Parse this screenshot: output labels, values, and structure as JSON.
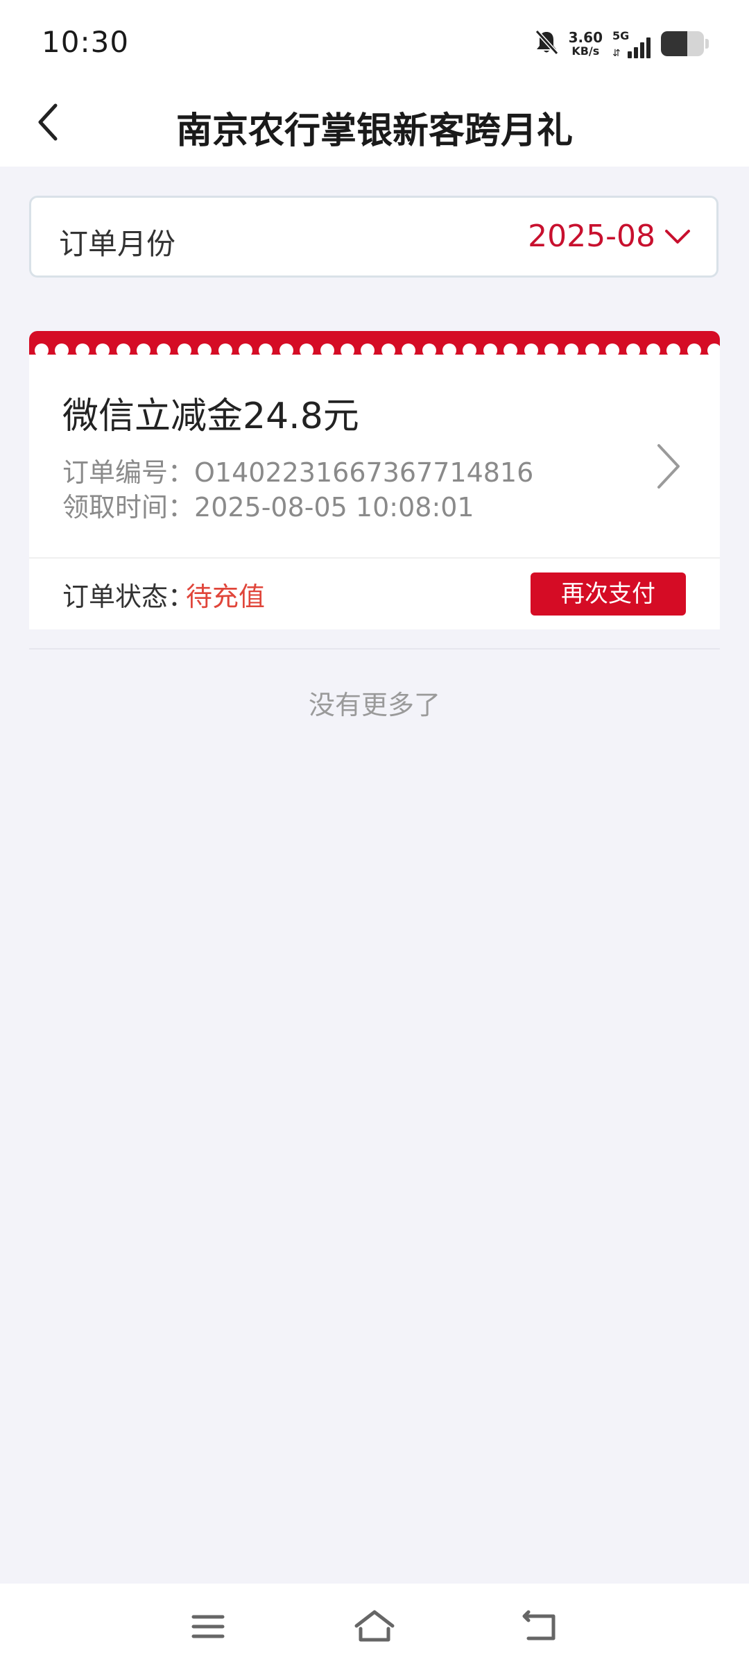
{
  "status_bar": {
    "time": "10:30",
    "net_speed_value": "3.60",
    "net_speed_unit": "KB/s",
    "network_type": "5G",
    "battery_level": 0.62,
    "icons": [
      "bell-off-icon",
      "signal-icon",
      "battery-icon"
    ]
  },
  "header": {
    "back_icon": "chevron-left-icon",
    "title": "南京农行掌银新客跨月礼"
  },
  "filter": {
    "label": "订单月份",
    "value": "2025-08",
    "dropdown_icon": "chevron-down-icon"
  },
  "order": {
    "title": "微信立减金24.8元",
    "order_no_label": "订单编号：",
    "order_no": "O1402231667367714816",
    "time_label": "领取时间：",
    "time": "2025-08-05 10:08:01",
    "status_label": "订单状态：",
    "status_value": "待充值",
    "action_label": "再次支付",
    "detail_icon": "chevron-right-icon"
  },
  "list_footer": "没有更多了",
  "nav": {
    "icons": [
      "menu-icon",
      "home-icon",
      "back-icon"
    ]
  },
  "colors": {
    "accent": "#d50c25",
    "month_text": "#c8102e",
    "status_pending": "#e0453a",
    "background": "#f3f3f9"
  }
}
